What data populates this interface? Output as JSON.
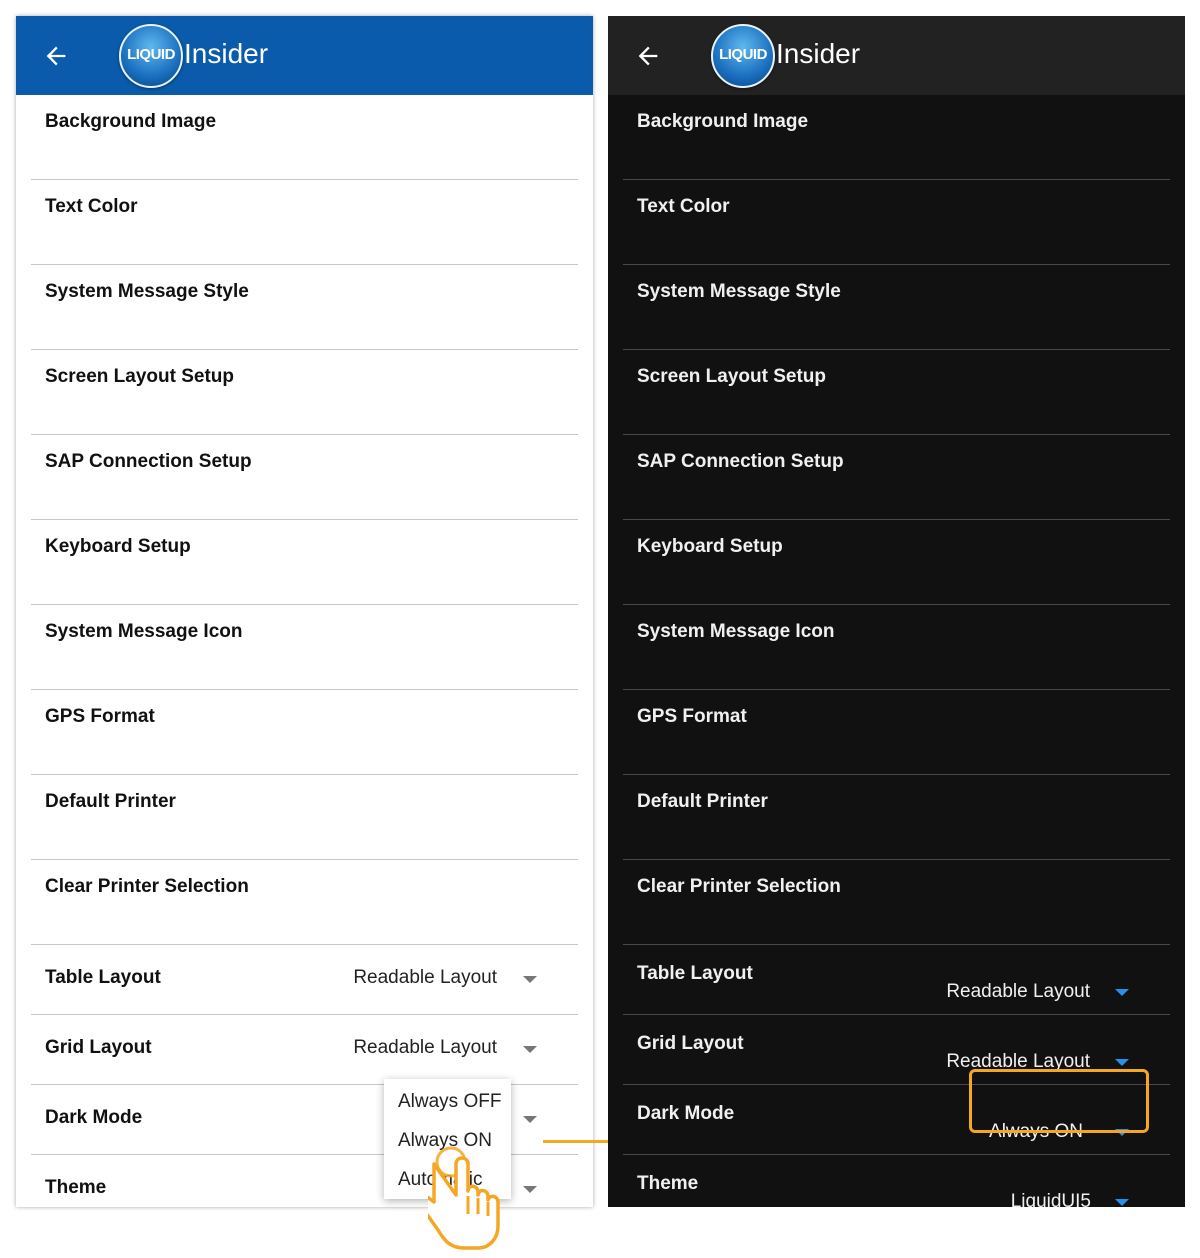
{
  "colors": {
    "light_header": "#0a5bab",
    "dark_header": "#222222",
    "dark_bg": "#111111",
    "accent_orange": "#f5a623",
    "dark_caret": "#2b8fe8"
  },
  "light": {
    "appbar": {
      "logo_text": "LIQUID",
      "title": "Insider"
    },
    "menu_items": [
      "Background Image",
      "Text Color",
      "System Message Style",
      "Screen Layout Setup",
      "SAP Connection Setup",
      "Keyboard Setup",
      "System Message Icon",
      "GPS Format",
      "Default Printer",
      "Clear Printer Selection"
    ],
    "settings": [
      {
        "label": "Table Layout",
        "value": "Readable Layout"
      },
      {
        "label": "Grid Layout",
        "value": "Readable Layout"
      },
      {
        "label": "Dark Mode",
        "value": ""
      },
      {
        "label": "Theme",
        "value": ""
      }
    ],
    "dropdown_options": [
      "Always OFF",
      "Always ON",
      "Automatic"
    ]
  },
  "dark": {
    "appbar": {
      "logo_text": "LIQUID",
      "title": "Insider"
    },
    "menu_items": [
      "Background Image",
      "Text Color",
      "System Message Style",
      "Screen Layout Setup",
      "SAP Connection Setup",
      "Keyboard Setup",
      "System Message Icon",
      "GPS Format",
      "Default Printer",
      "Clear Printer Selection"
    ],
    "settings": [
      {
        "label": "Table Layout",
        "value": "Readable Layout"
      },
      {
        "label": "Grid Layout",
        "value": "Readable Layout"
      },
      {
        "label": "Dark Mode",
        "value": "Always ON"
      },
      {
        "label": "Theme",
        "value": "LiquidUI5"
      }
    ]
  }
}
